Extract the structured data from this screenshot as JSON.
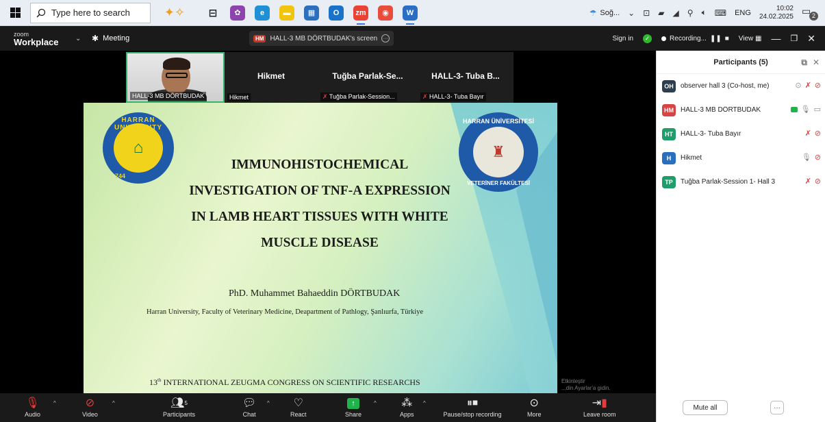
{
  "taskbar": {
    "search_placeholder": "Type here to search",
    "weather": "Soğ...",
    "lang": "ENG",
    "time": "10:02",
    "date": "24.02.2025",
    "notifications": "2",
    "apps": [
      {
        "name": "task-view",
        "color": "#e9eef4",
        "glyph": "⊟"
      },
      {
        "name": "app-multicolor",
        "color": "#8e44ad",
        "glyph": "✿"
      },
      {
        "name": "edge",
        "color": "#1f8fd6",
        "glyph": "e"
      },
      {
        "name": "file-explorer",
        "color": "#f1c40f",
        "glyph": "▬"
      },
      {
        "name": "store",
        "color": "#2c6fbf",
        "glyph": "▦"
      },
      {
        "name": "outlook",
        "color": "#1a73c8",
        "glyph": "O"
      },
      {
        "name": "zoom",
        "color": "#ea4335",
        "glyph": "zm"
      },
      {
        "name": "chrome",
        "color": "#e74c3c",
        "glyph": "◉"
      },
      {
        "name": "word",
        "color": "#2b6cc4",
        "glyph": "W"
      }
    ]
  },
  "zoom": {
    "logo_small": "zoom",
    "logo_big": "Workplace",
    "meeting_label": "Meeting",
    "share_badge": "HM",
    "share_text": "HALL-3 MB DÖRTBUDAK's screen",
    "sign_in": "Sign in",
    "recording": "Recording...",
    "view": "View"
  },
  "strip": {
    "self_name": "HALL-3 MB DÖRTBUDAK",
    "tiles": [
      {
        "big": "Hikmet",
        "small": "Hikmet"
      },
      {
        "big": "Tuğba Parlak-Se...",
        "small": "Tuğba Parlak-Session..."
      },
      {
        "big": "HALL-3- Tuba B...",
        "small": "HALL-3- Tuba Bayır"
      }
    ]
  },
  "slide": {
    "logo_left_text": "HARRAN UNIVERSITY",
    "logo_left_year": "744",
    "logo_right_top": "HARRAN ÜNİVERSİTESİ",
    "logo_right_bottom": "VETERİNER FAKÜLTESİ",
    "title_lines": [
      "IMMUNOHISTOCHEMICAL",
      "INVESTIGATION OF TNF-A EXPRESSION",
      "IN LAMB HEART TISSUES WITH WHITE",
      "MUSCLE DISEASE"
    ],
    "author": "PhD. Muhammet Bahaeddin DÖRTBUDAK",
    "affiliation": "Harran University, Faculty of Veterinary Medicine, Deapartment of Pathlogy, Şanlıurfa, Türkiye",
    "congress_prefix": "13",
    "congress_sup": "th",
    "congress_rest": " INTERNATIONAL ZEUGMA CONGRESS ON SCIENTIFIC RESEARCHS",
    "watermark_1": "Etkinleştir",
    "watermark_2": "...din Ayarlar'a gidin."
  },
  "toolbar": {
    "audio": "Audio",
    "video": "Video",
    "participants": "Participants",
    "participants_count": "5",
    "chat": "Chat",
    "react": "React",
    "share": "Share",
    "apps": "Apps",
    "pause_rec": "Pause/stop recording",
    "more": "More",
    "leave": "Leave room"
  },
  "panel": {
    "title": "Participants (5)",
    "participants": [
      {
        "initials": "OH",
        "color": "#2c3e50",
        "name": "observer hall 3 (Co-host, me)"
      },
      {
        "initials": "HM",
        "color": "#d64545",
        "name": "HALL-3 MB DÖRTBUDAK"
      },
      {
        "initials": "HT",
        "color": "#1f9d6b",
        "name": "HALL-3- Tuba Bayır"
      },
      {
        "initials": "H",
        "color": "#2a6fbd",
        "name": "Hikmet"
      },
      {
        "initials": "TP",
        "color": "#1f9d6b",
        "name": "Tuğba Parlak-Session 1- Hall 3"
      }
    ],
    "mute_all": "Mute all",
    "more": "···"
  }
}
